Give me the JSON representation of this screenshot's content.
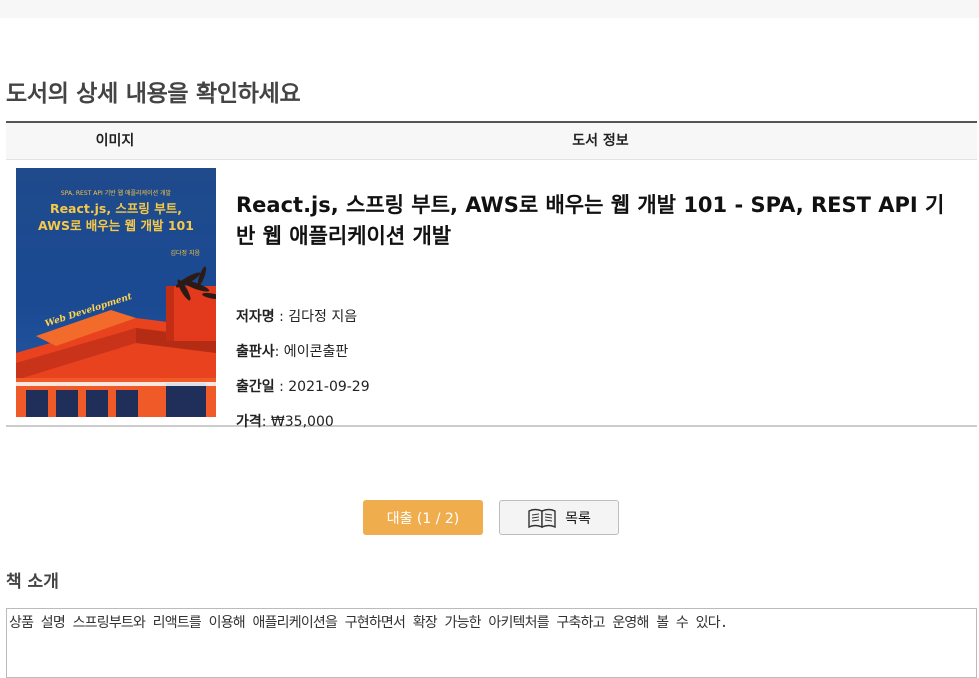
{
  "page": {
    "title": "도서의 상세 내용을 확인하세요"
  },
  "table": {
    "headers": {
      "image": "이미지",
      "info": "도서 정보"
    }
  },
  "cover": {
    "subtitle": "SPA, REST API 기반 웹 애플리케이션 개발",
    "title_line1": "React.js, 스프링 부트,",
    "title_line2": "AWS로 배우는 웹 개발 101",
    "author": "김다정 지음",
    "banner": "Web Development"
  },
  "book": {
    "title": "React.js, 스프링 부트, AWS로 배우는 웹 개발 101 - SPA, REST API 기반 웹 애플리케이션 개발",
    "author_label": "저자명",
    "author_value": " : 김다정 지음",
    "publisher_label": "출판사",
    "publisher_value": ": 에이콘출판",
    "pubdate_label": "출간일",
    "pubdate_value": " : 2021-09-29",
    "price_label": "가격",
    "price_value": ": ₩35,000"
  },
  "actions": {
    "loan_label": "대출 (1 / 2)",
    "list_label": "목록"
  },
  "intro": {
    "heading": "책 소개",
    "text": "상품 설명 스프링부트와 리액트를 이용해 애플리케이션을 구현하면서 확장 가능한 아키텍처를 구축하고 운영해 볼 수 있다."
  },
  "colors": {
    "loan_button": "#f0ad4e",
    "cover_blue": "#1f4a8c",
    "cover_orange": "#f05a28"
  },
  "icons": {
    "list": "book-icon"
  }
}
